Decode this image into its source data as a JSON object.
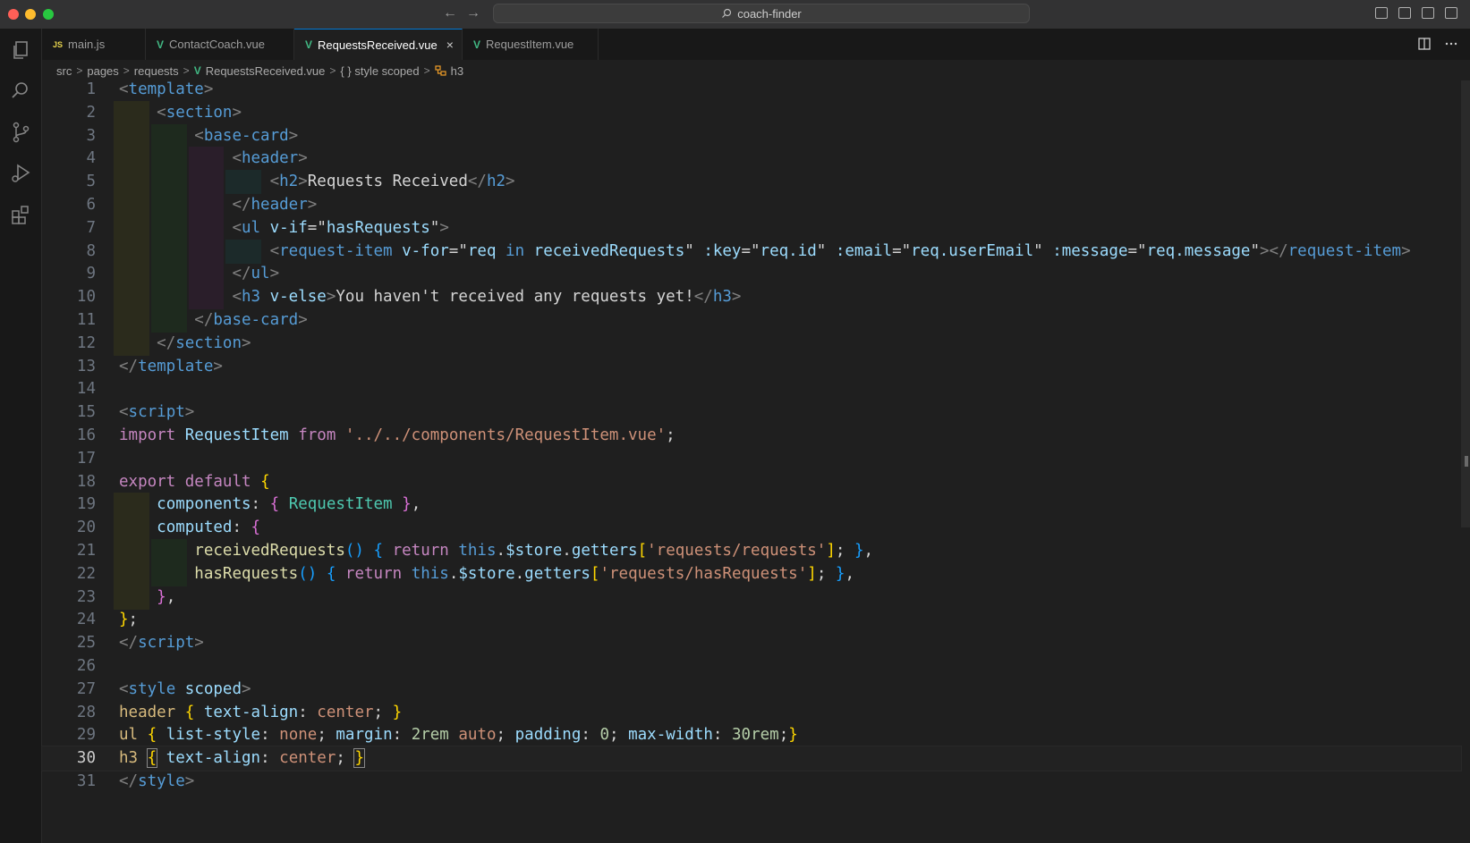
{
  "titlebar": {
    "search_text": "coach-finder"
  },
  "tabs": [
    {
      "label": "main.js",
      "type": "js",
      "active": false
    },
    {
      "label": "ContactCoach.vue",
      "type": "vue",
      "active": false
    },
    {
      "label": "RequestsReceived.vue",
      "type": "vue",
      "active": true
    },
    {
      "label": "RequestItem.vue",
      "type": "vue",
      "active": false
    }
  ],
  "tab_icons": {
    "js": "JS",
    "vue": "V",
    "close": "×"
  },
  "breadcrumb": {
    "items": [
      "src",
      "pages",
      "requests",
      "RequestsReceived.vue",
      "{ } style scoped",
      "h3"
    ],
    "separator": ">"
  },
  "editor": {
    "current_line": 30,
    "lines": [
      {
        "n": "1",
        "tokens": [
          [
            "p",
            "<"
          ],
          [
            "tg",
            "template"
          ],
          [
            "p",
            ">"
          ]
        ]
      },
      {
        "n": "2",
        "tokens": [
          [
            "tx",
            "    "
          ],
          [
            "p",
            "<"
          ],
          [
            "tg",
            "section"
          ],
          [
            "p",
            ">"
          ]
        ]
      },
      {
        "n": "3",
        "tokens": [
          [
            "tx",
            "        "
          ],
          [
            "p",
            "<"
          ],
          [
            "tg",
            "base-card"
          ],
          [
            "p",
            ">"
          ]
        ]
      },
      {
        "n": "4",
        "tokens": [
          [
            "tx",
            "            "
          ],
          [
            "p",
            "<"
          ],
          [
            "tg",
            "header"
          ],
          [
            "p",
            ">"
          ]
        ]
      },
      {
        "n": "5",
        "tokens": [
          [
            "tx",
            "                "
          ],
          [
            "p",
            "<"
          ],
          [
            "tg",
            "h2"
          ],
          [
            "p",
            ">"
          ],
          [
            "tx",
            "Requests Received"
          ],
          [
            "p",
            "</"
          ],
          [
            "tg",
            "h2"
          ],
          [
            "p",
            ">"
          ]
        ]
      },
      {
        "n": "6",
        "tokens": [
          [
            "tx",
            "            "
          ],
          [
            "p",
            "</"
          ],
          [
            "tg",
            "header"
          ],
          [
            "p",
            ">"
          ]
        ]
      },
      {
        "n": "7",
        "tokens": [
          [
            "tx",
            "            "
          ],
          [
            "p",
            "<"
          ],
          [
            "tg",
            "ul"
          ],
          [
            "tx",
            " "
          ],
          [
            "at",
            "v-if"
          ],
          [
            "tx",
            "="
          ],
          [
            "tx",
            "\""
          ],
          [
            "at",
            "hasRequests"
          ],
          [
            "tx",
            "\""
          ],
          [
            "p",
            ">"
          ]
        ]
      },
      {
        "n": "8",
        "tokens": [
          [
            "tx",
            "                "
          ],
          [
            "p",
            "<"
          ],
          [
            "tg",
            "request-item"
          ],
          [
            "tx",
            " "
          ],
          [
            "at",
            "v-for"
          ],
          [
            "tx",
            "=\""
          ],
          [
            "at",
            "req"
          ],
          [
            "tx",
            " "
          ],
          [
            "bl",
            "in"
          ],
          [
            "tx",
            " "
          ],
          [
            "at",
            "receivedRequests"
          ],
          [
            "tx",
            "\" "
          ],
          [
            "at",
            ":key"
          ],
          [
            "tx",
            "=\""
          ],
          [
            "at",
            "req.id"
          ],
          [
            "tx",
            "\" "
          ],
          [
            "at",
            ":email"
          ],
          [
            "tx",
            "=\""
          ],
          [
            "at",
            "req.userEmail"
          ],
          [
            "tx",
            "\" "
          ],
          [
            "at",
            ":message"
          ],
          [
            "tx",
            "=\""
          ],
          [
            "at",
            "req.message"
          ],
          [
            "tx",
            "\""
          ],
          [
            "p",
            "></"
          ],
          [
            "tg",
            "request-item"
          ],
          [
            "p",
            ">"
          ]
        ]
      },
      {
        "n": "9",
        "tokens": [
          [
            "tx",
            "            "
          ],
          [
            "p",
            "</"
          ],
          [
            "tg",
            "ul"
          ],
          [
            "p",
            ">"
          ]
        ]
      },
      {
        "n": "10",
        "tokens": [
          [
            "tx",
            "            "
          ],
          [
            "p",
            "<"
          ],
          [
            "tg",
            "h3"
          ],
          [
            "tx",
            " "
          ],
          [
            "at",
            "v-else"
          ],
          [
            "p",
            ">"
          ],
          [
            "tx",
            "You haven't received any requests yet!"
          ],
          [
            "p",
            "</"
          ],
          [
            "tg",
            "h3"
          ],
          [
            "p",
            ">"
          ]
        ]
      },
      {
        "n": "11",
        "tokens": [
          [
            "tx",
            "        "
          ],
          [
            "p",
            "</"
          ],
          [
            "tg",
            "base-card"
          ],
          [
            "p",
            ">"
          ]
        ]
      },
      {
        "n": "12",
        "tokens": [
          [
            "tx",
            "    "
          ],
          [
            "p",
            "</"
          ],
          [
            "tg",
            "section"
          ],
          [
            "p",
            ">"
          ]
        ]
      },
      {
        "n": "13",
        "tokens": [
          [
            "p",
            "</"
          ],
          [
            "tg",
            "template"
          ],
          [
            "p",
            ">"
          ]
        ]
      },
      {
        "n": "14",
        "tokens": []
      },
      {
        "n": "15",
        "tokens": [
          [
            "p",
            "<"
          ],
          [
            "tg",
            "script"
          ],
          [
            "p",
            ">"
          ]
        ]
      },
      {
        "n": "16",
        "tokens": [
          [
            "kw",
            "import"
          ],
          [
            "tx",
            " "
          ],
          [
            "at",
            "RequestItem"
          ],
          [
            "tx",
            " "
          ],
          [
            "kw",
            "from"
          ],
          [
            "tx",
            " "
          ],
          [
            "st",
            "'../../components/RequestItem.vue'"
          ],
          [
            "tx",
            ";"
          ]
        ]
      },
      {
        "n": "17",
        "tokens": []
      },
      {
        "n": "18",
        "tokens": [
          [
            "kw",
            "export"
          ],
          [
            "tx",
            " "
          ],
          [
            "kw",
            "default"
          ],
          [
            "tx",
            " "
          ],
          [
            "b1",
            "{"
          ]
        ]
      },
      {
        "n": "19",
        "tokens": [
          [
            "tx",
            "    "
          ],
          [
            "pr",
            "components"
          ],
          [
            "tx",
            ": "
          ],
          [
            "b2",
            "{"
          ],
          [
            "tx",
            " "
          ],
          [
            "cls",
            "RequestItem"
          ],
          [
            "tx",
            " "
          ],
          [
            "b2",
            "}"
          ],
          [
            "tx",
            ","
          ]
        ]
      },
      {
        "n": "20",
        "tokens": [
          [
            "tx",
            "    "
          ],
          [
            "pr",
            "computed"
          ],
          [
            "tx",
            ": "
          ],
          [
            "b2",
            "{"
          ]
        ]
      },
      {
        "n": "21",
        "tokens": [
          [
            "tx",
            "        "
          ],
          [
            "fn",
            "receivedRequests"
          ],
          [
            "b3",
            "()"
          ],
          [
            "tx",
            " "
          ],
          [
            "b3",
            "{"
          ],
          [
            "tx",
            " "
          ],
          [
            "kw",
            "return"
          ],
          [
            "tx",
            " "
          ],
          [
            "bl",
            "this"
          ],
          [
            "tx",
            "."
          ],
          [
            "pr",
            "$store"
          ],
          [
            "tx",
            "."
          ],
          [
            "pr",
            "getters"
          ],
          [
            "b1",
            "["
          ],
          [
            "st",
            "'requests/requests'"
          ],
          [
            "b1",
            "]"
          ],
          [
            "tx",
            "; "
          ],
          [
            "b3",
            "}"
          ],
          [
            "tx",
            ","
          ]
        ]
      },
      {
        "n": "22",
        "tokens": [
          [
            "tx",
            "        "
          ],
          [
            "fn",
            "hasRequests"
          ],
          [
            "b3",
            "()"
          ],
          [
            "tx",
            " "
          ],
          [
            "b3",
            "{"
          ],
          [
            "tx",
            " "
          ],
          [
            "kw",
            "return"
          ],
          [
            "tx",
            " "
          ],
          [
            "bl",
            "this"
          ],
          [
            "tx",
            "."
          ],
          [
            "pr",
            "$store"
          ],
          [
            "tx",
            "."
          ],
          [
            "pr",
            "getters"
          ],
          [
            "b1",
            "["
          ],
          [
            "st",
            "'requests/hasRequests'"
          ],
          [
            "b1",
            "]"
          ],
          [
            "tx",
            "; "
          ],
          [
            "b3",
            "}"
          ],
          [
            "tx",
            ","
          ]
        ]
      },
      {
        "n": "23",
        "tokens": [
          [
            "tx",
            "    "
          ],
          [
            "b2",
            "}"
          ],
          [
            "tx",
            ","
          ]
        ]
      },
      {
        "n": "24",
        "tokens": [
          [
            "b1",
            "}"
          ],
          [
            "tx",
            ";"
          ]
        ]
      },
      {
        "n": "25",
        "tokens": [
          [
            "p",
            "</"
          ],
          [
            "tg",
            "script"
          ],
          [
            "p",
            ">"
          ]
        ]
      },
      {
        "n": "26",
        "tokens": []
      },
      {
        "n": "27",
        "tokens": [
          [
            "p",
            "<"
          ],
          [
            "tg",
            "style"
          ],
          [
            "tx",
            " "
          ],
          [
            "at",
            "scoped"
          ],
          [
            "p",
            ">"
          ]
        ]
      },
      {
        "n": "28",
        "tokens": [
          [
            "sel",
            "header"
          ],
          [
            "tx",
            " "
          ],
          [
            "b1",
            "{"
          ],
          [
            "tx",
            " "
          ],
          [
            "pr",
            "text-align"
          ],
          [
            "tx",
            ": "
          ],
          [
            "st",
            "center"
          ],
          [
            "tx",
            "; "
          ],
          [
            "b1",
            "}"
          ]
        ]
      },
      {
        "n": "29",
        "tokens": [
          [
            "sel",
            "ul"
          ],
          [
            "tx",
            " "
          ],
          [
            "b1",
            "{"
          ],
          [
            "tx",
            " "
          ],
          [
            "pr",
            "list-style"
          ],
          [
            "tx",
            ": "
          ],
          [
            "st",
            "none"
          ],
          [
            "tx",
            "; "
          ],
          [
            "pr",
            "margin"
          ],
          [
            "tx",
            ": "
          ],
          [
            "num",
            "2rem"
          ],
          [
            "tx",
            " "
          ],
          [
            "st",
            "auto"
          ],
          [
            "tx",
            "; "
          ],
          [
            "pr",
            "padding"
          ],
          [
            "tx",
            ": "
          ],
          [
            "num",
            "0"
          ],
          [
            "tx",
            "; "
          ],
          [
            "pr",
            "max-width"
          ],
          [
            "tx",
            ": "
          ],
          [
            "num",
            "30rem"
          ],
          [
            "tx",
            ";"
          ],
          [
            "b1",
            "}"
          ]
        ]
      },
      {
        "n": "30",
        "tokens": [
          [
            "sel",
            "h3"
          ],
          [
            "tx",
            " "
          ],
          [
            "b1 bm",
            "{"
          ],
          [
            "tx",
            " "
          ],
          [
            "pr",
            "text-align"
          ],
          [
            "tx",
            ": "
          ],
          [
            "st",
            "center"
          ],
          [
            "tx",
            "; "
          ],
          [
            "b1 bm",
            "}"
          ]
        ]
      },
      {
        "n": "31",
        "tokens": [
          [
            "p",
            "</"
          ],
          [
            "tg",
            "style"
          ],
          [
            "p",
            ">"
          ]
        ]
      }
    ]
  }
}
